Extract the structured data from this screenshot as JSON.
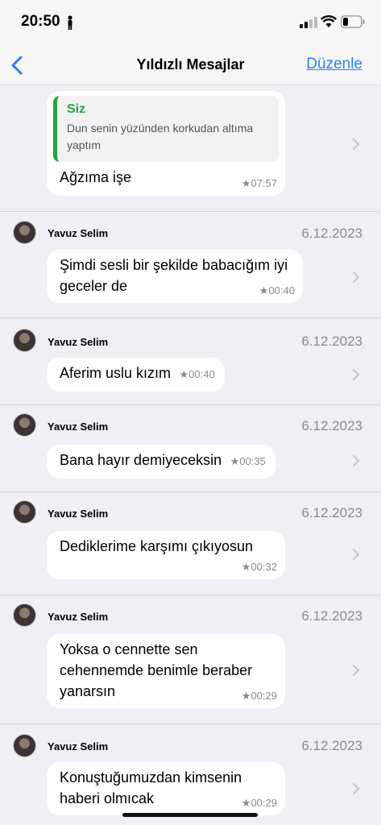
{
  "status": {
    "time": "20:50"
  },
  "nav": {
    "title": "Yıldızlı Mesajlar",
    "edit": "Düzenle"
  },
  "first": {
    "quote_name": "Siz",
    "quote_text": "Dun senin yüzünden korkudan altıma yaptım",
    "text": "Ağzıma işe",
    "time": "07:57"
  },
  "items": [
    {
      "sender": "Yavuz Selim",
      "date": "6.12.2023",
      "text": "Şimdi sesli bir şekilde babacığım iyi geceler de",
      "time": "00:40"
    },
    {
      "sender": "Yavuz Selim",
      "date": "6.12.2023",
      "text": "Aferim uslu kızım",
      "time": "00:40"
    },
    {
      "sender": "Yavuz Selim",
      "date": "6.12.2023",
      "text": "Bana hayır demiyeceksin",
      "time": "00:35"
    },
    {
      "sender": "Yavuz Selim",
      "date": "6.12.2023",
      "text": "Dediklerime karşımı çıkıyosun",
      "time": "00:32"
    },
    {
      "sender": "Yavuz Selim",
      "date": "6.12.2023",
      "text": "Yoksa o cennette sen cehennemde benimle beraber yanarsın",
      "time": "00:29"
    },
    {
      "sender": "Yavuz Selim",
      "date": "6.12.2023",
      "text": "Konuştuğumuzdan kimsenin haberi olmıcak",
      "time": "00:29"
    }
  ],
  "star": "★"
}
